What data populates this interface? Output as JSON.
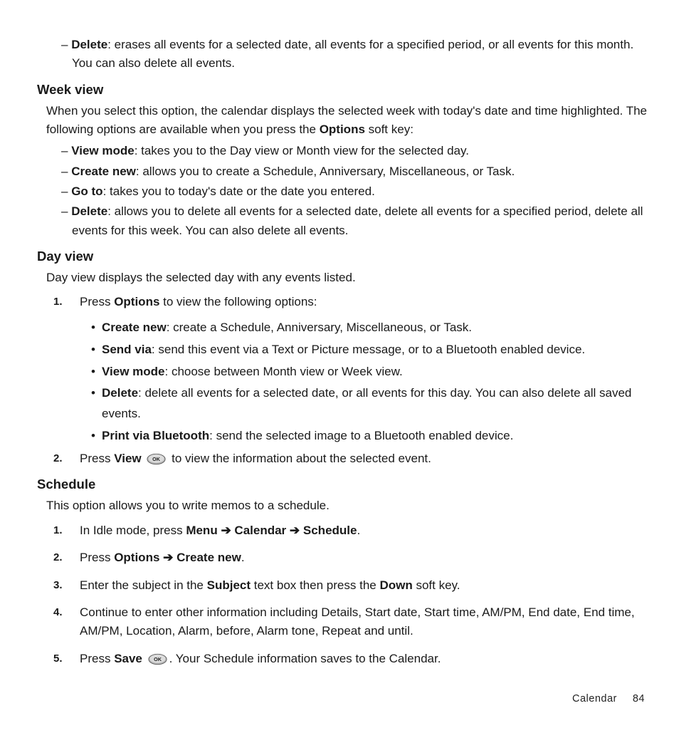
{
  "top_delete": {
    "label": "Delete",
    "text": ": erases all events for a selected date, all events for a specified period, or all events for this month. You can also delete all events."
  },
  "week": {
    "heading": "Week view",
    "intro_pre": "When you select this option, the calendar displays the selected week with today's date and time highlighted. The following options are available when you press the ",
    "intro_bold": "Options",
    "intro_post": " soft key:",
    "items": [
      {
        "label": "View mode",
        "text": ": takes you to the Day view or Month view for the selected day."
      },
      {
        "label": "Create new",
        "text": ": allows you to create a Schedule, Anniversary, Miscellaneous, or Task."
      },
      {
        "label": "Go to",
        "text": ": takes you to today's date or the date you entered."
      },
      {
        "label": "Delete",
        "text": ": allows you to delete all events for a selected date, delete all events for a specified period, delete all events for this week. You can also delete all events."
      }
    ]
  },
  "day": {
    "heading": "Day view",
    "intro": "Day view displays the selected day with any events listed.",
    "step1_pre": "Press ",
    "step1_bold": "Options",
    "step1_post": " to view the following options:",
    "bullets": [
      {
        "label": "Create new",
        "text": ": create a Schedule, Anniversary, Miscellaneous, or Task."
      },
      {
        "label": "Send via",
        "text": ": send this event via a Text or Picture message, or to a Bluetooth enabled device."
      },
      {
        "label": "View mode",
        "text": ": choose between Month view or Week view."
      },
      {
        "label": "Delete",
        "text": ": delete all events for a selected date, or all events for this day. You can also delete all saved events."
      },
      {
        "label": "Print via Bluetooth",
        "text": ": send the selected image to a Bluetooth enabled device."
      }
    ],
    "step2_pre": "Press ",
    "step2_bold": "View",
    "step2_post": " to view the information about the selected event."
  },
  "schedule": {
    "heading": "Schedule",
    "intro": "This option allows you to write memos to a schedule.",
    "s1_pre": "In Idle mode, press ",
    "s1_b1": "Menu",
    "s1_b2": "Calendar",
    "s1_b3": "Schedule",
    "s2_pre": "Press ",
    "s2_b1": "Options",
    "s2_b2": "Create new",
    "s3_pre": "Enter the subject in the ",
    "s3_b1": "Subject",
    "s3_mid": " text box then press the ",
    "s3_b2": "Down",
    "s3_post": " soft key.",
    "s4": "Continue to enter other information including Details, Start date, Start time, AM/PM, End date, End time, AM/PM, Location, Alarm, before, Alarm tone, Repeat and until.",
    "s5_pre": "Press ",
    "s5_b": "Save",
    "s5_post": ". Your Schedule information saves to the Calendar."
  },
  "footer": {
    "section": "Calendar",
    "page": "84"
  },
  "nums": {
    "n1": "1.",
    "n2": "2.",
    "n3": "3.",
    "n4": "4.",
    "n5": "5."
  },
  "arrow": "➔",
  "ok_label": "OK"
}
